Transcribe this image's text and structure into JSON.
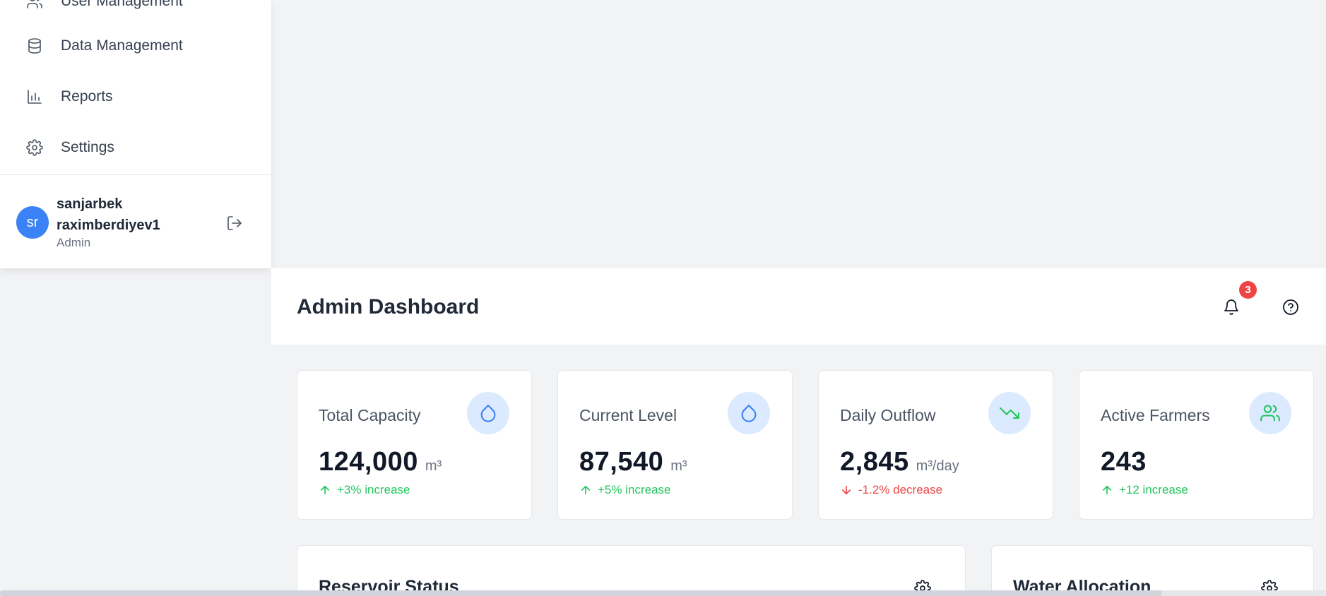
{
  "sidebar": {
    "items": [
      {
        "label": "User Management",
        "icon": "users-icon"
      },
      {
        "label": "Data Management",
        "icon": "database-icon"
      },
      {
        "label": "Reports",
        "icon": "bar-chart-icon"
      },
      {
        "label": "Settings",
        "icon": "gear-icon"
      }
    ],
    "user": {
      "initials": "sr",
      "name": "sanjarbek raximberdiyev1",
      "role": "Admin"
    }
  },
  "header": {
    "title": "Admin Dashboard",
    "notification_count": "3"
  },
  "stats": [
    {
      "title": "Total Capacity",
      "value": "124,000",
      "unit": "m³",
      "change": "+3% increase",
      "direction": "up",
      "icon": "droplet-icon",
      "icon_color": "#3b82f6",
      "icon_bg": "#dbeafe"
    },
    {
      "title": "Current Level",
      "value": "87,540",
      "unit": "m³",
      "change": "+5% increase",
      "direction": "up",
      "icon": "droplet-icon",
      "icon_color": "#3b82f6",
      "icon_bg": "#dbeafe"
    },
    {
      "title": "Daily Outflow",
      "value": "2,845",
      "unit": "m³/day",
      "change": "-1.2% decrease",
      "direction": "down",
      "icon": "trending-down-icon",
      "icon_color": "#22c55e",
      "icon_bg": "#dbeafe"
    },
    {
      "title": "Active Farmers",
      "value": "243",
      "unit": "",
      "change": "+12 increase",
      "direction": "up",
      "icon": "users-icon",
      "icon_color": "#22c55e",
      "icon_bg": "#dbeafe"
    }
  ],
  "panels": [
    {
      "title": "Reservoir Status"
    },
    {
      "title": "Water Allocation"
    }
  ],
  "colors": {
    "accent": "#3b82f6",
    "positive": "#22c55e",
    "negative": "#ef4444",
    "badge": "#ef4444"
  }
}
